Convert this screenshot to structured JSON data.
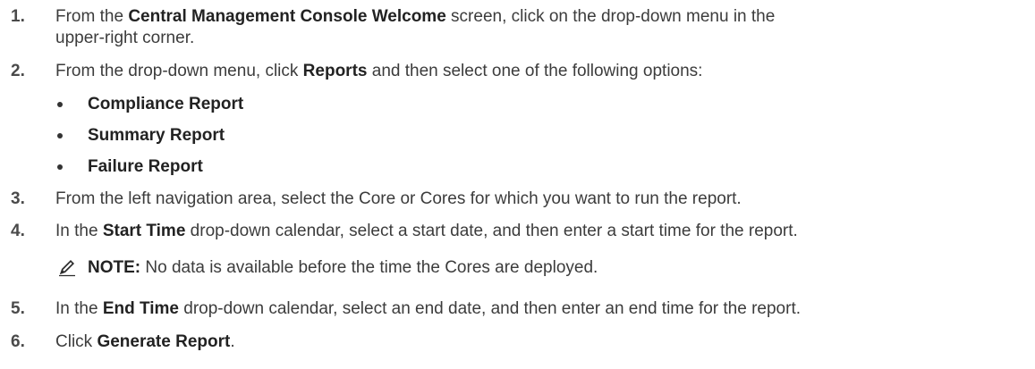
{
  "steps": [
    {
      "number": "1.",
      "parts": [
        "From the ",
        "Central Management Console Welcome",
        " screen, click on the drop-down menu in the",
        "upper-right corner."
      ]
    },
    {
      "number": "2.",
      "parts": [
        "From the drop-down menu, click ",
        "Reports",
        " and then select one of the following options:"
      ],
      "options": [
        "Compliance Report",
        "Summary Report",
        "Failure Report"
      ]
    },
    {
      "number": "3.",
      "text": "From the left navigation area, select the Core or Cores for which you want to run the report."
    },
    {
      "number": "4.",
      "parts": [
        "In the ",
        "Start Time",
        " drop-down calendar, select a start date, and then enter a start time for the report."
      ],
      "note": {
        "label": "NOTE:",
        "text": " No data is available before the time the Cores are deployed.",
        "icon": "note-pencil-icon"
      }
    },
    {
      "number": "5.",
      "parts": [
        "In the ",
        "End Time",
        " drop-down calendar, select an end date, and then enter an end time for the report."
      ]
    },
    {
      "number": "6.",
      "parts": [
        "Click ",
        "Generate Report",
        "."
      ]
    }
  ]
}
